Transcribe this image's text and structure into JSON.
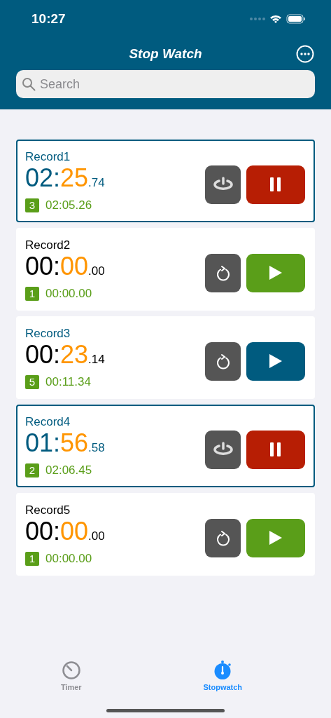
{
  "status_bar": {
    "time": "10:27"
  },
  "header": {
    "title": "Stop Watch"
  },
  "search": {
    "placeholder": "Search"
  },
  "records": [
    {
      "name": "Record1",
      "kind": "running",
      "minutes": "02",
      "separator": ":",
      "seconds": "25",
      "fraction": ".74",
      "lap_count": "3",
      "lap_time": "02:05.26"
    },
    {
      "name": "Record2",
      "kind": "idle",
      "minutes": "00",
      "separator": ":",
      "seconds": "00",
      "fraction": ".00",
      "lap_count": "1",
      "lap_time": "00:00.00"
    },
    {
      "name": "Record3",
      "kind": "paused",
      "minutes": "00",
      "separator": ":",
      "seconds": "23",
      "fraction": ".14",
      "lap_count": "5",
      "lap_time": "00:11.34"
    },
    {
      "name": "Record4",
      "kind": "running",
      "minutes": "01",
      "separator": ":",
      "seconds": "56",
      "fraction": ".58",
      "lap_count": "2",
      "lap_time": "02:06.45"
    },
    {
      "name": "Record5",
      "kind": "idle",
      "minutes": "00",
      "separator": ":",
      "seconds": "00",
      "fraction": ".00",
      "lap_count": "1",
      "lap_time": "00:00.00"
    }
  ],
  "tabs": [
    {
      "label": "Timer",
      "selected": false
    },
    {
      "label": "Stopwatch",
      "selected": true
    }
  ]
}
